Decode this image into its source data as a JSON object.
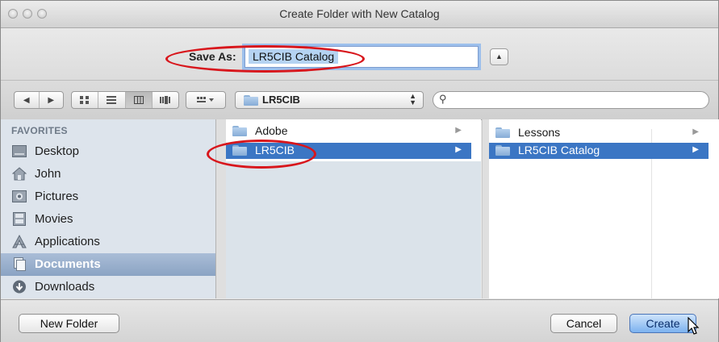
{
  "window": {
    "title": "Create Folder with New Catalog"
  },
  "save_as": {
    "label": "Save As:",
    "value": "LR5CIB Catalog"
  },
  "toolbar": {
    "nav": [
      "◀",
      "▶"
    ],
    "view_modes": [
      "icon-view",
      "list-view",
      "column-view",
      "coverflow-view"
    ],
    "active_view": "column-view",
    "arrange_icon": "arrange-icon",
    "path_folder": "LR5CIB",
    "search_placeholder": ""
  },
  "sidebar": {
    "heading": "FAVORITES",
    "items": [
      {
        "label": "Desktop",
        "icon": "desktop-icon"
      },
      {
        "label": "John",
        "icon": "home-icon"
      },
      {
        "label": "Pictures",
        "icon": "pictures-icon"
      },
      {
        "label": "Movies",
        "icon": "movies-icon"
      },
      {
        "label": "Applications",
        "icon": "applications-icon"
      },
      {
        "label": "Documents",
        "icon": "documents-icon",
        "selected": true
      },
      {
        "label": "Downloads",
        "icon": "downloads-icon"
      }
    ]
  },
  "column1": {
    "items": [
      {
        "label": "Adobe",
        "selected": false
      },
      {
        "label": "LR5CIB",
        "selected": true
      }
    ]
  },
  "column2": {
    "items": [
      {
        "label": "Lessons",
        "selected": false
      },
      {
        "label": "LR5CIB Catalog",
        "selected": true
      }
    ]
  },
  "buttons": {
    "new_folder": "New Folder",
    "cancel": "Cancel",
    "create": "Create"
  },
  "colors": {
    "selection": "#3b76c4",
    "annotation": "#d8161c",
    "sidebar_bg": "#dde4ec"
  }
}
